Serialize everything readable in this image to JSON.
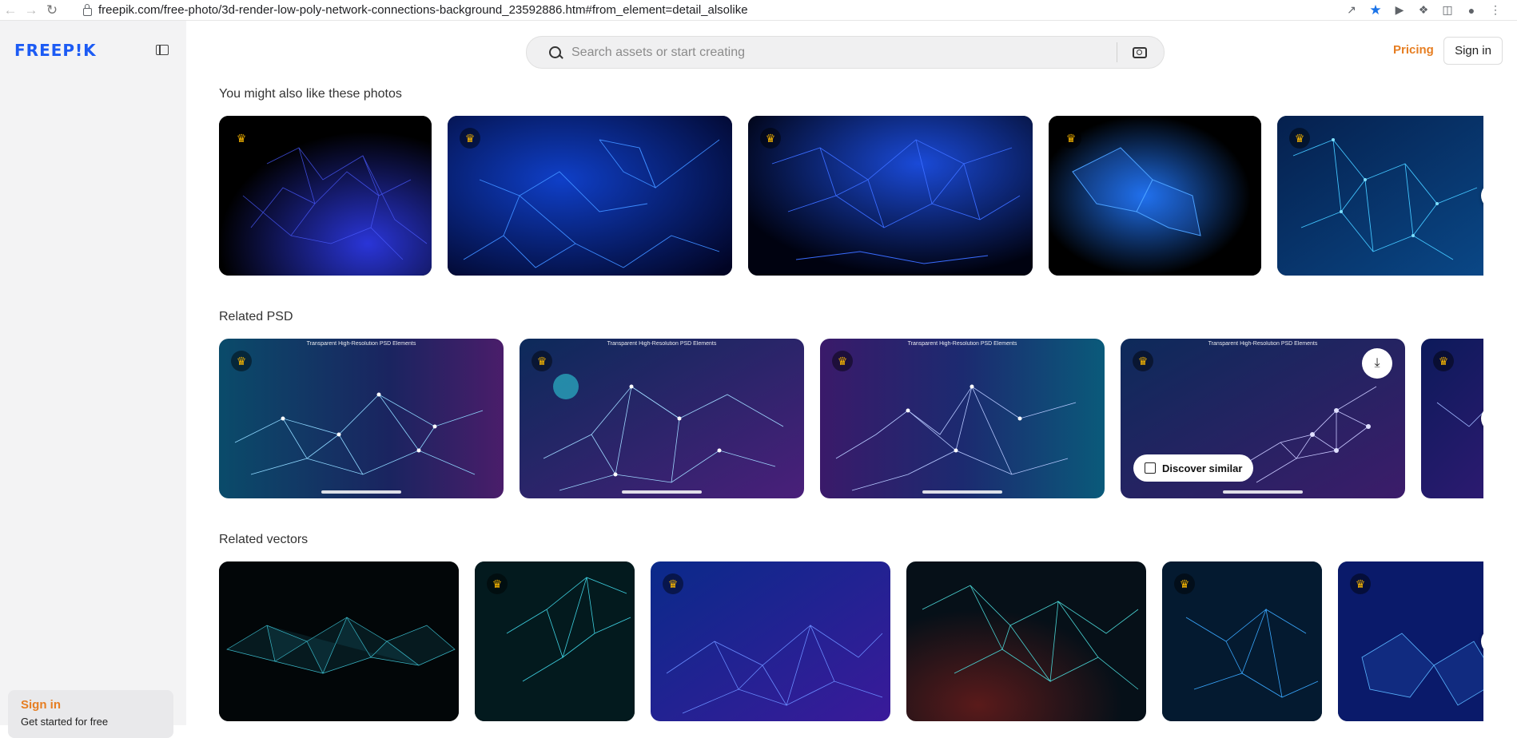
{
  "browser": {
    "url": "freepik.com/free-photo/3d-render-low-poly-network-connections-background_23592886.htm#from_element=detail_alsolike"
  },
  "sidebar": {
    "logo": "FREEP!K",
    "signin": "Sign in",
    "signin_sub": "Get started for free"
  },
  "header": {
    "search_placeholder": "Search assets or start creating",
    "pricing": "Pricing",
    "signin": "Sign in"
  },
  "sections": {
    "photos": {
      "title": "You might also like these photos"
    },
    "psd": {
      "title": "Related PSD",
      "tag": "Transparent High-Resolution PSD Elements",
      "discover": "Discover similar"
    },
    "vectors": {
      "title": "Related vectors"
    }
  },
  "icons": {
    "crown": "crown-icon",
    "next": "chevron-right-icon",
    "download": "download-icon",
    "search": "search-icon",
    "camera": "camera-icon"
  },
  "colors": {
    "brand": "#1c5bf4",
    "accent": "#e67e22",
    "premium": "#f5b400"
  }
}
